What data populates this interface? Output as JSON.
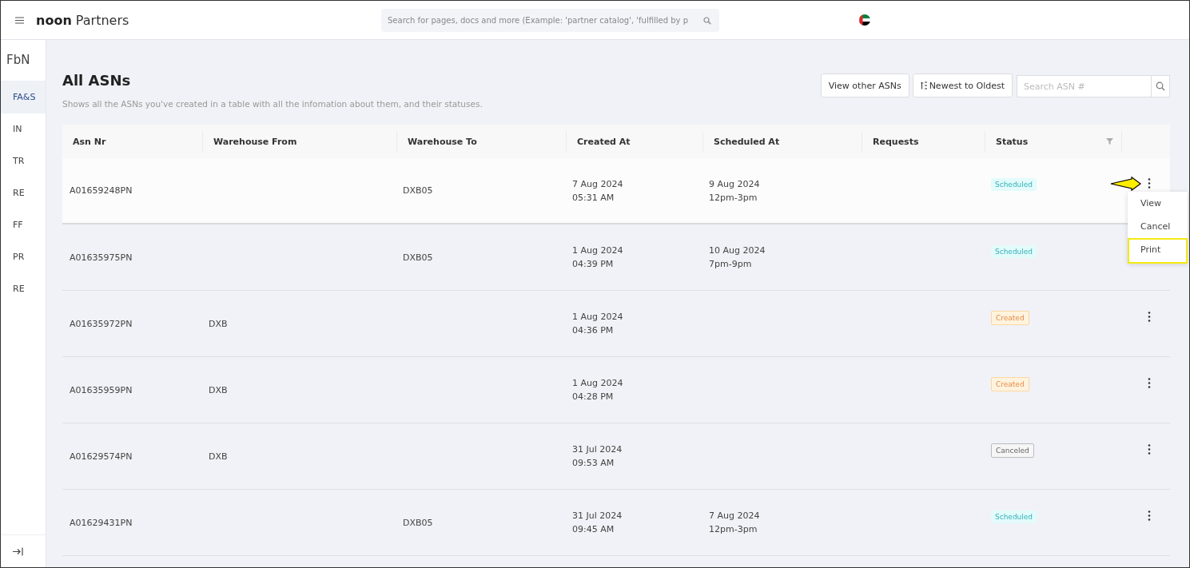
{
  "topbar": {
    "brand_bold": "noon",
    "brand_rest": "Partners",
    "search": {
      "placeholder": "Search for pages, docs and more (Example: 'partner catalog', 'fulfilled by p"
    }
  },
  "sidebar": {
    "title": "FbN",
    "items": [
      {
        "label": "FA&S",
        "selected": true
      },
      {
        "label": "IN",
        "selected": false
      },
      {
        "label": "TR",
        "selected": false
      },
      {
        "label": "RE",
        "selected": false
      },
      {
        "label": "FF",
        "selected": false
      },
      {
        "label": "PR",
        "selected": false
      },
      {
        "label": "RE",
        "selected": false
      }
    ]
  },
  "page": {
    "title": "All ASNs",
    "subtitle": "Shows all the ASNs you've created in a table with all the infomation about them, and their statuses.",
    "view_other_button": "View other ASNs",
    "sort_button": "Newest to Oldest",
    "search": {
      "placeholder": "Search ASN #"
    }
  },
  "table": {
    "columns": [
      {
        "label": "Asn Nr",
        "filter": false
      },
      {
        "label": "Warehouse From",
        "filter": false
      },
      {
        "label": "Warehouse To",
        "filter": false
      },
      {
        "label": "Created At",
        "filter": false
      },
      {
        "label": "Scheduled At",
        "filter": false
      },
      {
        "label": "Requests",
        "filter": false
      },
      {
        "label": "Status",
        "filter": true
      }
    ],
    "rows": [
      {
        "asn": "A01659248PN",
        "to": "DXB05",
        "created_date": "7 Aug 2024",
        "created_time": "05:31 AM",
        "scheduled_date": "9 Aug 2024",
        "scheduled_time": "12pm-3pm",
        "status": {
          "label": "Scheduled",
          "kind": "scheduled"
        },
        "hovered": true,
        "menu_open": true
      },
      {
        "asn": "A01635975PN",
        "to": "DXB05",
        "created_date": "1 Aug 2024",
        "created_time": "04:39 PM",
        "scheduled_date": "10 Aug 2024",
        "scheduled_time": "7pm-9pm",
        "status": {
          "label": "Scheduled",
          "kind": "scheduled"
        },
        "hovered": false,
        "menu_open": false
      },
      {
        "asn": "A01635972PN",
        "from": "DXB",
        "created_date": "1 Aug 2024",
        "created_time": "04:36 PM",
        "status": {
          "label": "Created",
          "kind": "created"
        },
        "hovered": false,
        "menu_open": false
      },
      {
        "asn": "A01635959PN",
        "from": "DXB",
        "created_date": "1 Aug 2024",
        "created_time": "04:28 PM",
        "status": {
          "label": "Created",
          "kind": "created"
        },
        "hovered": false,
        "menu_open": false
      },
      {
        "asn": "A01629574PN",
        "from": "DXB",
        "created_date": "31 Jul 2024",
        "created_time": "09:53 AM",
        "status": {
          "label": "Canceled",
          "kind": "canceled"
        },
        "hovered": false,
        "menu_open": false
      },
      {
        "asn": "A01629431PN",
        "to": "DXB05",
        "created_date": "31 Jul 2024",
        "created_time": "09:45 AM",
        "scheduled_date": "7 Aug 2024",
        "scheduled_time": "12pm-3pm",
        "status": {
          "label": "Scheduled",
          "kind": "scheduled"
        },
        "hovered": false,
        "menu_open": false
      }
    ],
    "row_menu": [
      {
        "label": "View",
        "selected": false
      },
      {
        "label": "Cancel",
        "selected": false
      },
      {
        "label": "Print",
        "selected": true
      }
    ]
  }
}
